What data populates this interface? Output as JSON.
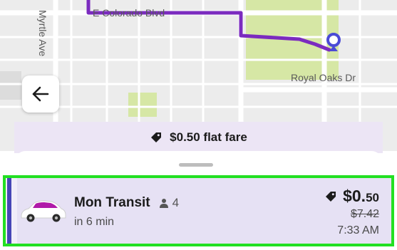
{
  "map": {
    "streets": {
      "colorado": "E Colorado Blvd",
      "myrtle": "Myrtle Ave",
      "royal_oaks": "Royal Oaks Dr"
    },
    "route_color": "#7b2bbf",
    "park_color": "#d6e7a5",
    "icons": {
      "back": "arrow-left-icon",
      "destination": "location-pin-icon"
    }
  },
  "fare_banner": {
    "text": "$0.50 flat fare",
    "icon": "fare-tag-icon"
  },
  "ride_option": {
    "provider": "Mon Transit",
    "seats": "4",
    "seats_icon": "person-icon",
    "eta": "in 6 min",
    "price_main": "$0.",
    "price_cents": "50",
    "price_icon": "discount-tag-icon",
    "original_price": "$7.42",
    "arrival_time": "7:33 AM",
    "vehicle_icon": "car-icon",
    "accent_color": "#4646b6",
    "highlight_color": "#22e022"
  }
}
